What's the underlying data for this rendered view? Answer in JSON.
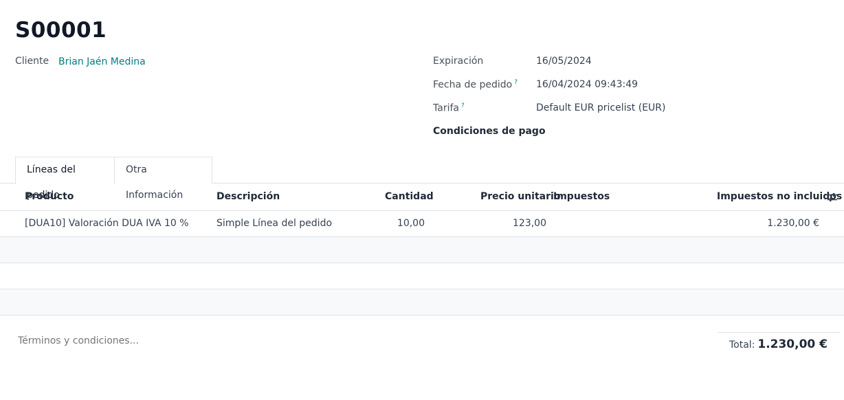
{
  "order": {
    "title": "S00001"
  },
  "fields": {
    "customer_label": "Cliente",
    "customer_value": "Brian Jaén Medina",
    "expiration_label": "Expiración",
    "expiration_value": "16/05/2024",
    "order_date_label": "Fecha de pedido",
    "order_date_value": "16/04/2024 09:43:49",
    "pricelist_label": "Tarifa",
    "pricelist_value": "Default EUR pricelist (EUR)",
    "payment_terms_label": "Condiciones de pago",
    "help_mark": "?"
  },
  "tabs": [
    {
      "label": "Líneas del pedido",
      "active": true
    },
    {
      "label": "Otra Información",
      "active": false
    }
  ],
  "table": {
    "headers": {
      "product": "Producto",
      "description": "Descripción",
      "quantity": "Cantidad",
      "unit_price": "Precio unitario",
      "taxes": "Impuestos",
      "subtotal": "Impuestos no incluidos"
    },
    "rows": [
      {
        "product": "[DUA10] Valoración DUA IVA 10 %",
        "description": "Simple Línea del pedido",
        "quantity": "10,00",
        "unit_price": "123,00",
        "taxes": "",
        "subtotal": "1.230,00 €"
      }
    ]
  },
  "footer": {
    "terms_placeholder": "Términos y condiciones...",
    "total_label": "Total:",
    "total_value": "1.230,00 €"
  },
  "colors": {
    "link": "#017e84",
    "border": "#dee2e6"
  }
}
